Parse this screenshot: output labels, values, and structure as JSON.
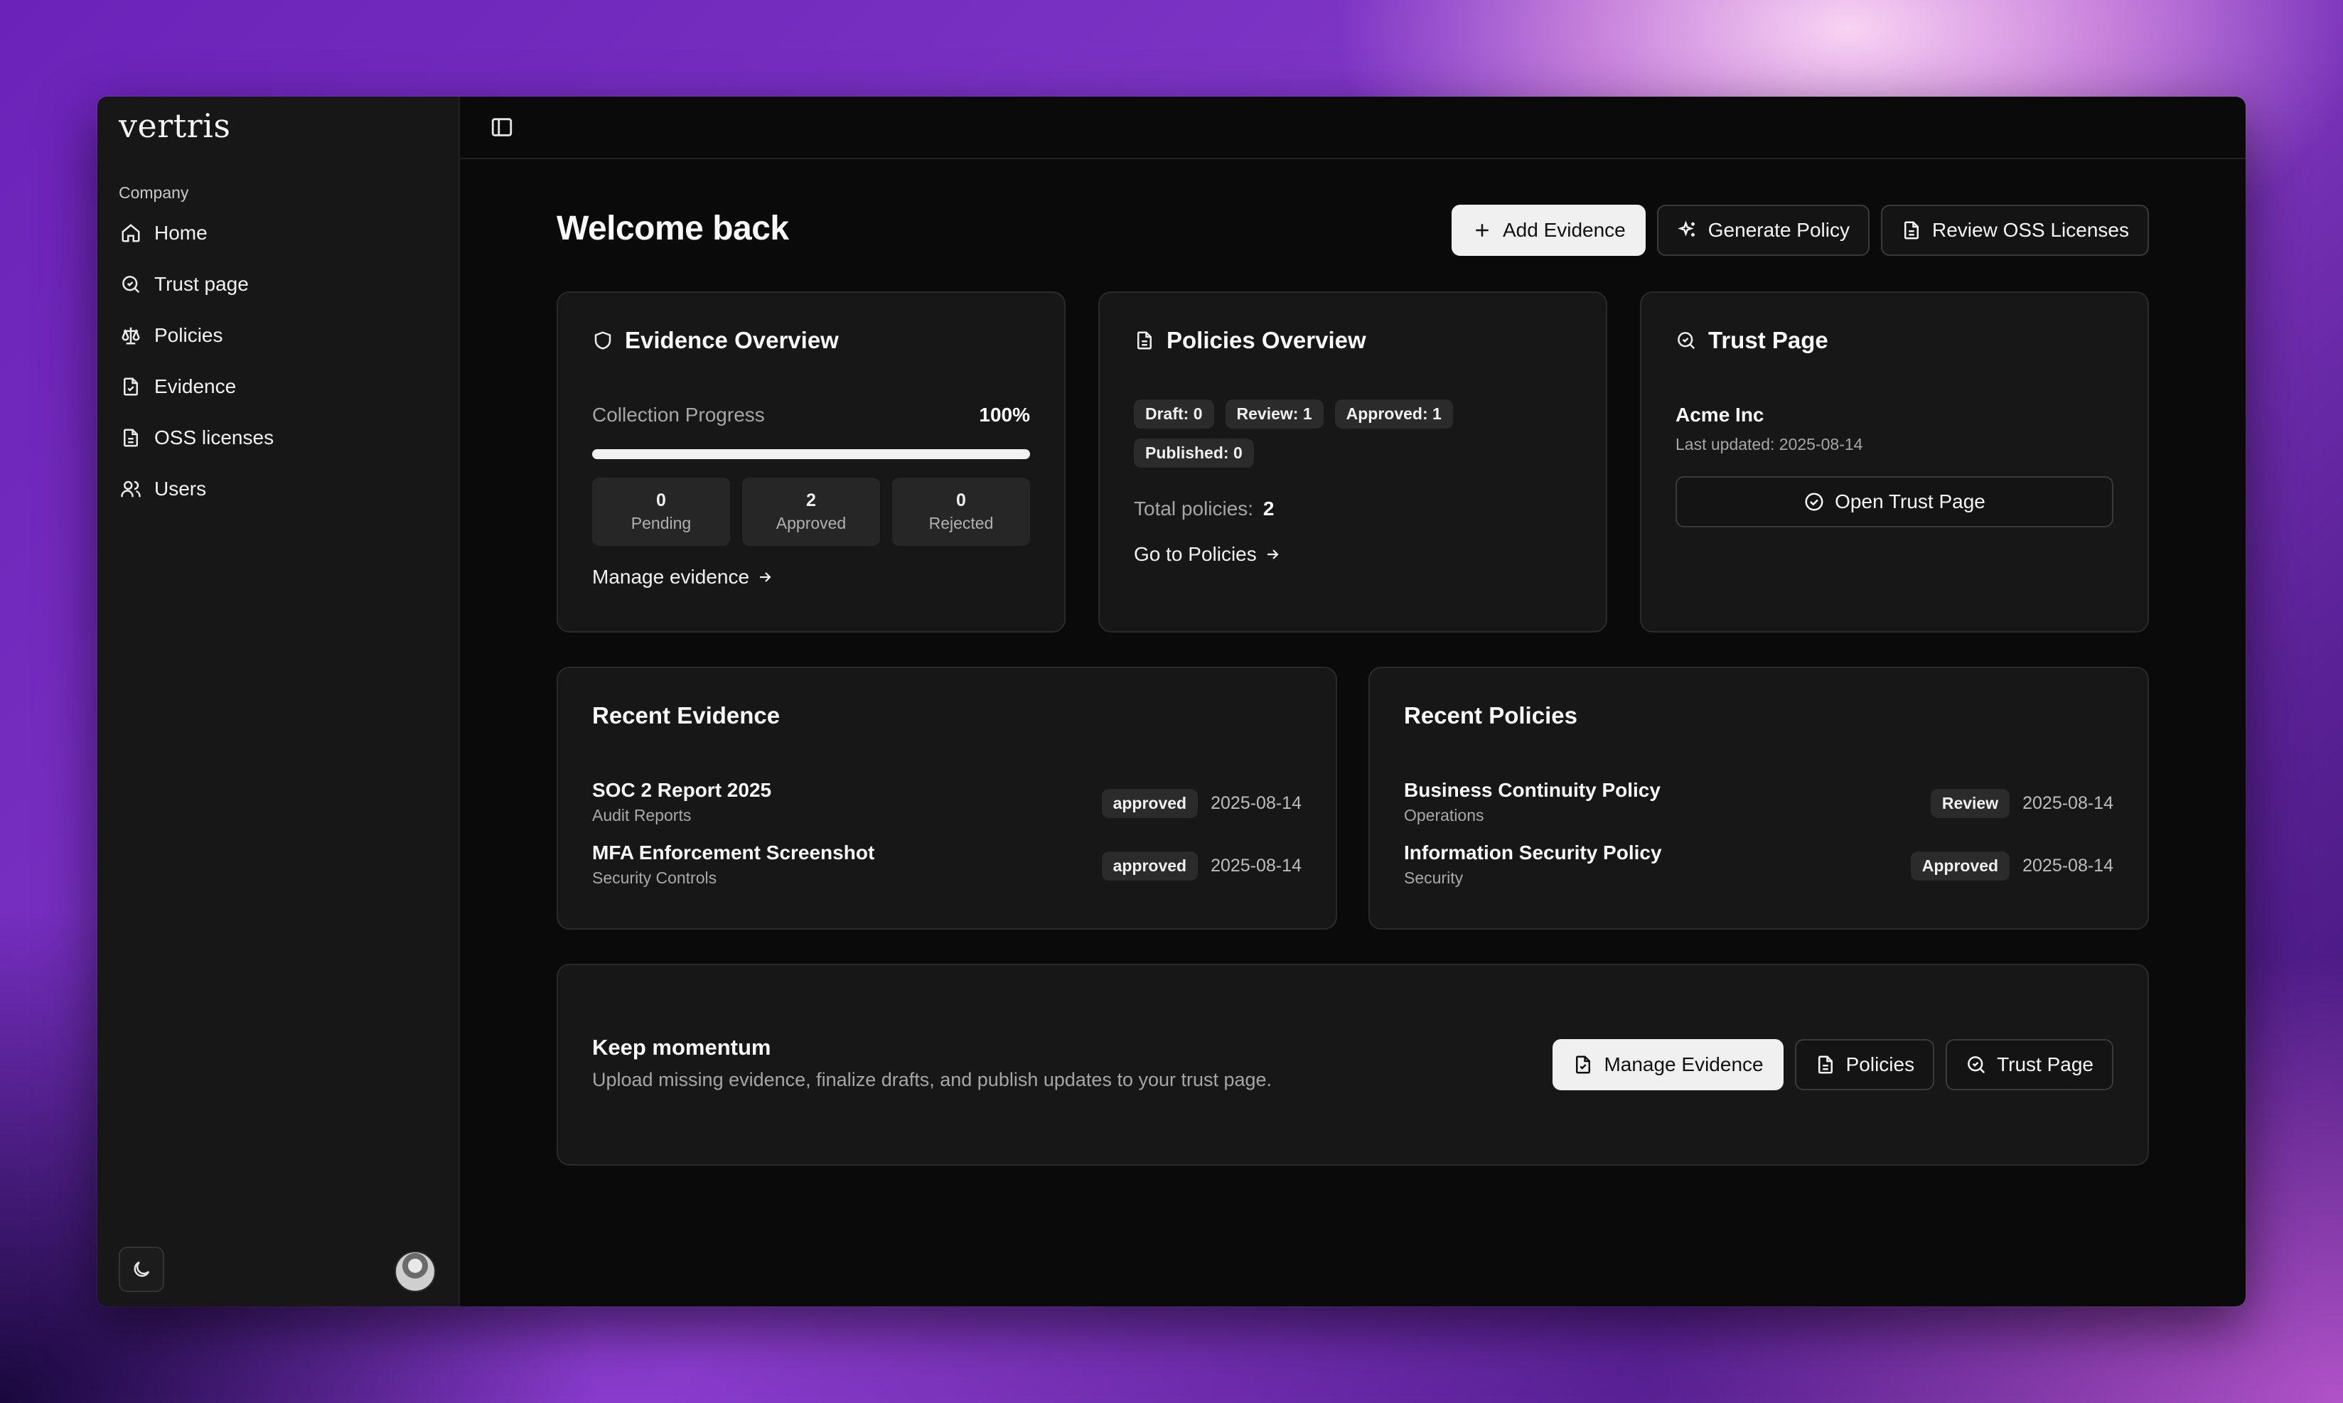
{
  "app": {
    "logo": "vertris"
  },
  "sidebar": {
    "group_label": "Company",
    "items": [
      {
        "label": "Home",
        "icon": "home-icon"
      },
      {
        "label": "Trust page",
        "icon": "search-badge-icon"
      },
      {
        "label": "Policies",
        "icon": "scale-icon"
      },
      {
        "label": "Evidence",
        "icon": "file-check-icon"
      },
      {
        "label": "OSS licenses",
        "icon": "file-text-icon"
      },
      {
        "label": "Users",
        "icon": "users-icon"
      }
    ]
  },
  "header": {
    "title": "Welcome back",
    "actions": [
      {
        "label": "Add Evidence",
        "icon": "plus-icon"
      },
      {
        "label": "Generate Policy",
        "icon": "sparkles-icon"
      },
      {
        "label": "Review OSS Licenses",
        "icon": "file-text-icon"
      }
    ]
  },
  "evidence_overview": {
    "title": "Evidence Overview",
    "progress_label": "Collection Progress",
    "progress_text": "100%",
    "progress_value": 1.0,
    "stats": [
      {
        "value": "0",
        "label": "Pending"
      },
      {
        "value": "2",
        "label": "Approved"
      },
      {
        "value": "0",
        "label": "Rejected"
      }
    ],
    "link": "Manage evidence"
  },
  "policies_overview": {
    "title": "Policies Overview",
    "pills": [
      "Draft: 0",
      "Review: 1",
      "Approved: 1",
      "Published: 0"
    ],
    "total_label": "Total policies:",
    "total_value": "2",
    "link": "Go to Policies"
  },
  "trust_page": {
    "title": "Trust Page",
    "company": "Acme Inc",
    "updated": "Last updated: 2025-08-14",
    "button": "Open Trust Page"
  },
  "recent_evidence": {
    "title": "Recent Evidence",
    "rows": [
      {
        "name": "SOC 2 Report 2025",
        "category": "Audit Reports",
        "status": "approved",
        "date": "2025-08-14"
      },
      {
        "name": "MFA Enforcement Screenshot",
        "category": "Security Controls",
        "status": "approved",
        "date": "2025-08-14"
      }
    ]
  },
  "recent_policies": {
    "title": "Recent Policies",
    "rows": [
      {
        "name": "Business Continuity Policy",
        "category": "Operations",
        "status": "Review",
        "date": "2025-08-14"
      },
      {
        "name": "Information Security Policy",
        "category": "Security",
        "status": "Approved",
        "date": "2025-08-14"
      }
    ]
  },
  "momentum": {
    "title": "Keep momentum",
    "subtitle": "Upload missing evidence, finalize drafts, and publish updates to your trust page.",
    "actions": [
      {
        "label": "Manage Evidence",
        "icon": "file-check-icon"
      },
      {
        "label": "Policies",
        "icon": "file-text-icon"
      },
      {
        "label": "Trust Page",
        "icon": "search-badge-icon"
      }
    ]
  }
}
